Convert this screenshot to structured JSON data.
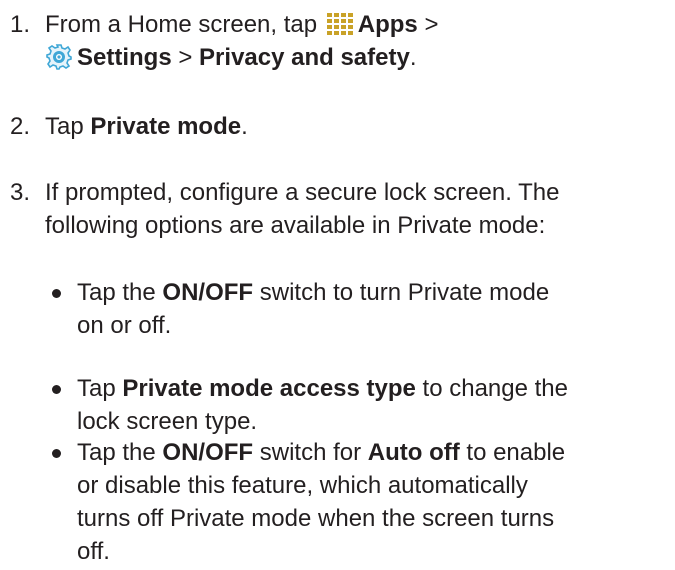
{
  "steps": [
    {
      "number": "1.",
      "line1_pre": "From a Home screen, tap",
      "apps_label": "Apps",
      "sep1": " >",
      "settings_label": "Settings",
      "sep2": " > ",
      "privacy_label": "Privacy and safety",
      "end": "."
    },
    {
      "number": "2.",
      "pre": "Tap ",
      "bold": "Private mode",
      "end": "."
    },
    {
      "number": "3.",
      "line1": "If prompted, configure a secure lock screen. The",
      "line2": "following options are available in Private mode:"
    }
  ],
  "bullets": [
    {
      "pre": "Tap the ",
      "bold1": "ON/OFF",
      "mid": " switch to turn Private mode",
      "line2": "on or off."
    },
    {
      "pre": "Tap ",
      "bold1": "Private mode access type",
      "mid": " to change the",
      "line2": "lock screen type."
    },
    {
      "pre": "Tap the ",
      "bold1": "ON/OFF",
      "mid1": " switch for ",
      "bold2": "Auto off",
      "mid2": " to enable",
      "line2": "or disable this feature, which automatically",
      "line3": "turns off Private mode when the screen turns",
      "line4": "off."
    }
  ],
  "icons": {
    "apps": "apps-grid-icon",
    "settings": "settings-gear-icon"
  },
  "colors": {
    "text": "#231f20",
    "apps_icon": "#c9a227",
    "settings_icon": "#3fa7d6"
  }
}
